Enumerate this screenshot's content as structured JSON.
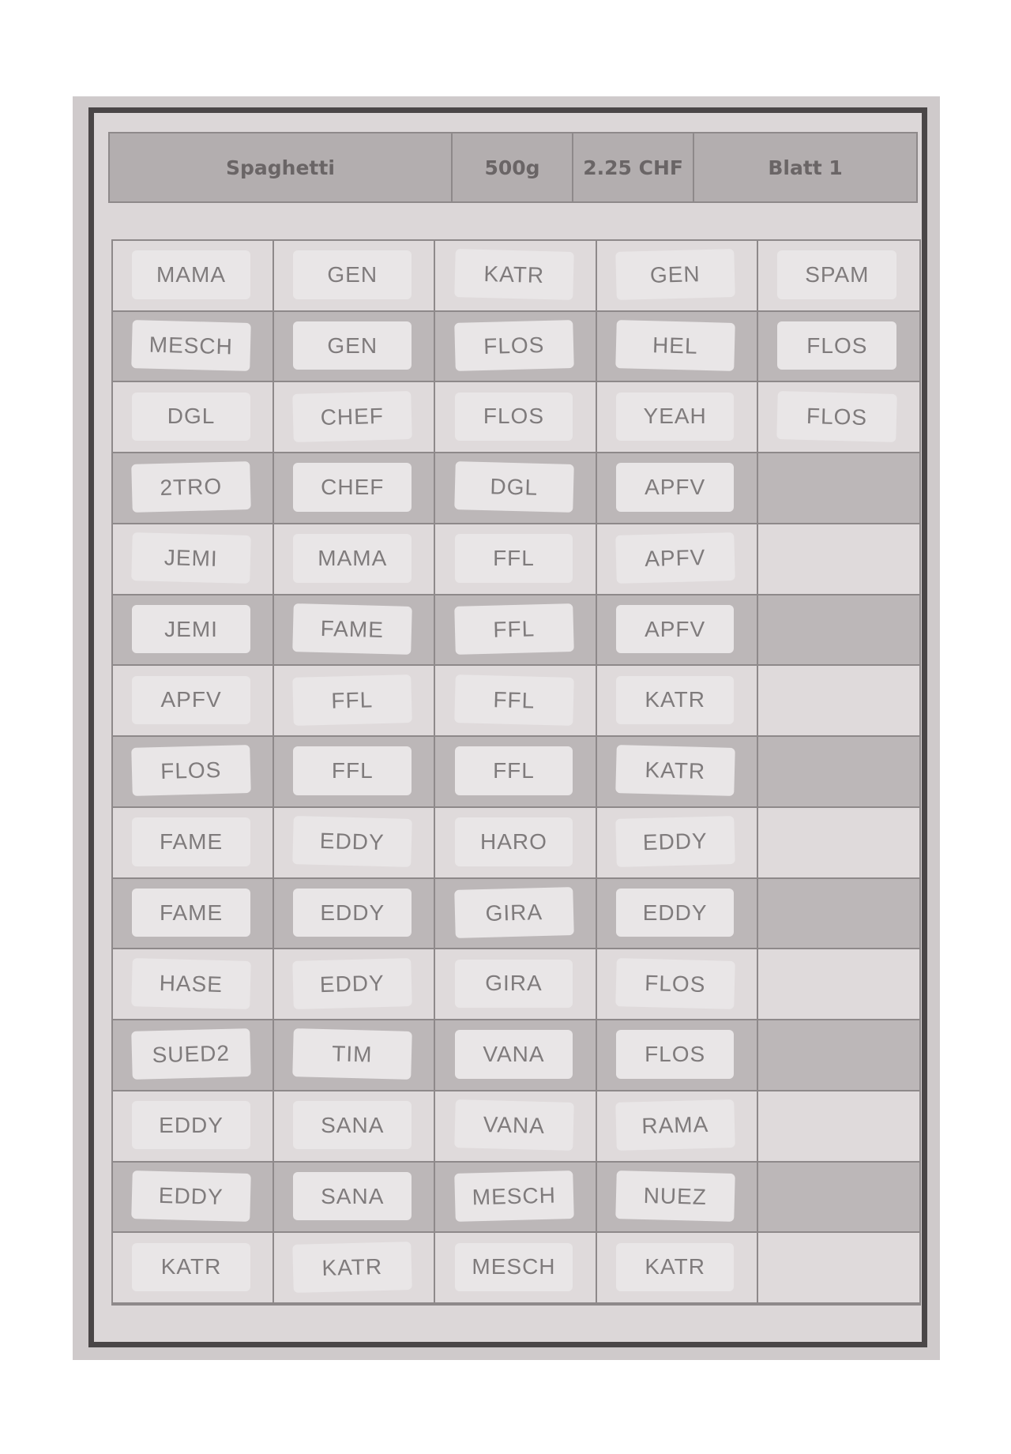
{
  "header": {
    "product": "Spaghetti",
    "weight": "500g",
    "price": "2.25 CHF",
    "sheet": "Blatt 1"
  },
  "grid": {
    "columns": 5,
    "rows": [
      [
        "MAMA",
        "GEN",
        "KATR",
        "GEN",
        "SPAM"
      ],
      [
        "MESCH",
        "GEN",
        "FLOS",
        "HEL",
        "FLOS"
      ],
      [
        "DGL",
        "CHEF",
        "FLOS",
        "YEAH",
        "FLOS"
      ],
      [
        "2TRO",
        "CHEF",
        "DGL",
        "APFV",
        ""
      ],
      [
        "JEMI",
        "MAMA",
        "FFL",
        "APFV",
        ""
      ],
      [
        "JEMI",
        "FAME",
        "FFL",
        "APFV",
        ""
      ],
      [
        "APFV",
        "FFL",
        "FFL",
        "KATR",
        ""
      ],
      [
        "FLOS",
        "FFL",
        "FFL",
        "KATR",
        ""
      ],
      [
        "FAME",
        "EDDY",
        "HARO",
        "EDDY",
        ""
      ],
      [
        "FAME",
        "EDDY",
        "GIRA",
        "EDDY",
        ""
      ],
      [
        "HASE",
        "EDDY",
        "GIRA",
        "FLOS",
        ""
      ],
      [
        "SUED2",
        "TIM",
        "VANA",
        "FLOS",
        ""
      ],
      [
        "EDDY",
        "SANA",
        "VANA",
        "RAMA",
        ""
      ],
      [
        "EDDY",
        "SANA",
        "MESCH",
        "NUEZ",
        ""
      ],
      [
        "KATR",
        "KATR",
        "MESCH",
        "KATR",
        ""
      ]
    ]
  }
}
